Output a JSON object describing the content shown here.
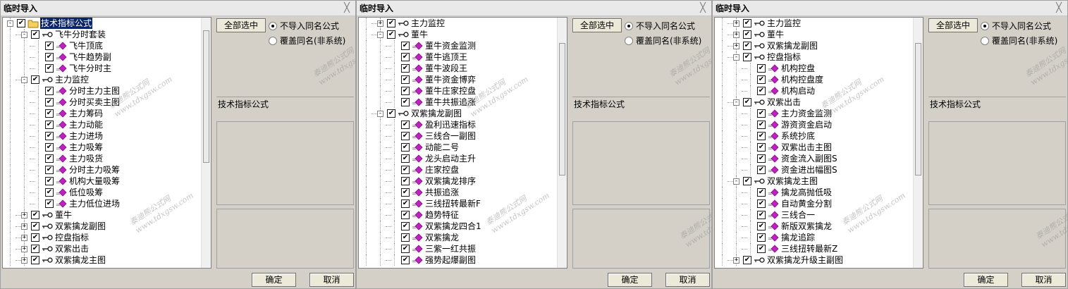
{
  "dialogs": [
    {
      "title": "临时导入",
      "scroll": {
        "thumb_top_frac": 0.05,
        "thumb_size_frac": 0.53
      },
      "rows": [
        {
          "level": 0,
          "exp": "-",
          "icon": "folder",
          "label": "技术指标公式",
          "selected": true
        },
        {
          "level": 1,
          "exp": "-",
          "icon": "key",
          "label": "飞牛分时套装"
        },
        {
          "level": 2,
          "icon": "formula",
          "label": "飞牛顶底"
        },
        {
          "level": 2,
          "icon": "formula",
          "label": "飞牛趋势副"
        },
        {
          "level": 2,
          "icon": "formula",
          "label": "飞牛分时主"
        },
        {
          "level": 1,
          "exp": "-",
          "icon": "key",
          "label": "主力监控"
        },
        {
          "level": 2,
          "icon": "formula",
          "label": "分时主力主图"
        },
        {
          "level": 2,
          "icon": "formula",
          "label": "分时买卖主图"
        },
        {
          "level": 2,
          "icon": "formula",
          "label": "主力筹码"
        },
        {
          "level": 2,
          "icon": "formula",
          "label": "主力动能"
        },
        {
          "level": 2,
          "icon": "formula",
          "label": "主力进场"
        },
        {
          "level": 2,
          "icon": "formula",
          "label": "主力吸筹"
        },
        {
          "level": 2,
          "icon": "formula",
          "label": "主力吸货"
        },
        {
          "level": 2,
          "icon": "formula",
          "label": "分时主力吸筹"
        },
        {
          "level": 2,
          "icon": "formula",
          "label": "机构大量吸筹"
        },
        {
          "level": 2,
          "icon": "formula",
          "label": "低位吸筹"
        },
        {
          "level": 2,
          "icon": "formula",
          "label": "主力低位进场"
        },
        {
          "level": 1,
          "exp": "+",
          "icon": "key",
          "label": "董牛"
        },
        {
          "level": 1,
          "exp": "+",
          "icon": "key",
          "label": "双紫擒龙副图"
        },
        {
          "level": 1,
          "exp": "+",
          "icon": "key",
          "label": "控盘指标"
        },
        {
          "level": 1,
          "exp": "+",
          "icon": "key",
          "label": "双紫出击"
        },
        {
          "level": 1,
          "exp": "+",
          "icon": "key",
          "label": "双紫擒龙主图"
        }
      ]
    },
    {
      "title": "临时导入",
      "scroll": {
        "thumb_top_frac": 0.1,
        "thumb_size_frac": 0.53
      },
      "rows": [
        {
          "level": 1,
          "exp": "+",
          "icon": "key",
          "label": "主力监控"
        },
        {
          "level": 1,
          "exp": "-",
          "icon": "key",
          "label": "董牛"
        },
        {
          "level": 2,
          "icon": "formula",
          "label": "董牛资金监测"
        },
        {
          "level": 2,
          "icon": "formula",
          "label": "董牛逃顶王"
        },
        {
          "level": 2,
          "icon": "formula",
          "label": "董牛波段王"
        },
        {
          "level": 2,
          "icon": "formula",
          "label": "董牛资金博弈"
        },
        {
          "level": 2,
          "icon": "formula",
          "label": "董牛庄家控盘"
        },
        {
          "level": 2,
          "icon": "formula",
          "label": "董牛共振追涨"
        },
        {
          "level": 1,
          "exp": "-",
          "icon": "key",
          "label": "双紫擒龙副图"
        },
        {
          "level": 2,
          "icon": "formula",
          "label": "盈利迅速指标"
        },
        {
          "level": 2,
          "icon": "formula",
          "label": "三线合一副图"
        },
        {
          "level": 2,
          "icon": "formula",
          "label": "动能二号"
        },
        {
          "level": 2,
          "icon": "formula",
          "label": "龙头启动主升"
        },
        {
          "level": 2,
          "icon": "formula",
          "label": "庄家控盘"
        },
        {
          "level": 2,
          "icon": "formula",
          "label": "双紫擒龙排序"
        },
        {
          "level": 2,
          "icon": "formula",
          "label": "共振追涨"
        },
        {
          "level": 2,
          "icon": "formula",
          "label": "三线扭转最新F"
        },
        {
          "level": 2,
          "icon": "formula",
          "label": "趋势特征"
        },
        {
          "level": 2,
          "icon": "formula",
          "label": "双紫擒龙四合1"
        },
        {
          "level": 2,
          "icon": "formula",
          "label": "双紫擒龙"
        },
        {
          "level": 2,
          "icon": "formula",
          "label": "三紫一红共振"
        },
        {
          "level": 2,
          "icon": "formula",
          "label": "强势起爆副图"
        }
      ]
    },
    {
      "title": "临时导入",
      "scroll": {
        "thumb_top_frac": 0.1,
        "thumb_size_frac": 0.53
      },
      "rows": [
        {
          "level": 1,
          "exp": "+",
          "icon": "key",
          "label": "主力监控"
        },
        {
          "level": 1,
          "exp": "+",
          "icon": "key",
          "label": "董牛"
        },
        {
          "level": 1,
          "exp": "+",
          "icon": "key",
          "label": "双紫擒龙副图"
        },
        {
          "level": 1,
          "exp": "-",
          "icon": "key",
          "label": "控盘指标"
        },
        {
          "level": 2,
          "icon": "formula",
          "label": "机构控盘"
        },
        {
          "level": 2,
          "icon": "formula",
          "label": "机构控盘度"
        },
        {
          "level": 2,
          "icon": "formula",
          "label": "机构启动"
        },
        {
          "level": 1,
          "exp": "-",
          "icon": "key",
          "label": "双紫出击"
        },
        {
          "level": 2,
          "icon": "formula",
          "label": "主力资金监测"
        },
        {
          "level": 2,
          "icon": "formula",
          "label": "游资资金启动"
        },
        {
          "level": 2,
          "icon": "formula",
          "label": "系统抄底"
        },
        {
          "level": 2,
          "icon": "formula",
          "label": "双紫出击主图"
        },
        {
          "level": 2,
          "icon": "formula",
          "label": "资金流入副图S"
        },
        {
          "level": 2,
          "icon": "formula",
          "label": "资金进出幅图S"
        },
        {
          "level": 1,
          "exp": "-",
          "icon": "key",
          "label": "双紫擒龙主图"
        },
        {
          "level": 2,
          "icon": "formula",
          "label": "擒龙高抛低吸"
        },
        {
          "level": 2,
          "icon": "formula",
          "label": "自动黄金分割"
        },
        {
          "level": 2,
          "icon": "formula",
          "label": "三线合一"
        },
        {
          "level": 2,
          "icon": "formula",
          "label": "新版双紫擒龙"
        },
        {
          "level": 2,
          "icon": "formula",
          "label": "擒龙追踪"
        },
        {
          "level": 2,
          "icon": "formula",
          "label": "三线扭转最新Z"
        },
        {
          "level": 1,
          "exp": "+",
          "icon": "key",
          "label": "双紫擒龙升级主副图"
        }
      ]
    }
  ],
  "controls": {
    "select_all": "全部选中",
    "radio_skip": "不导入同名公式",
    "radio_overwrite": "覆盖同名(非系统)",
    "info_label": "技术指标公式",
    "ok": "确定",
    "cancel": "取消"
  },
  "watermark": {
    "text_cn": "泰迪熊公式网",
    "text_url": "www.tdxgsw.com"
  },
  "colors": {
    "selection": "#0a246a",
    "folder": "#f5d05a",
    "formula": "#c020c0"
  }
}
